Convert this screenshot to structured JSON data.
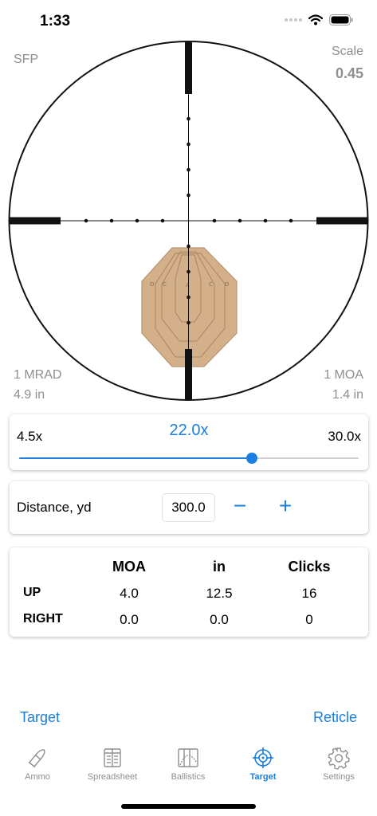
{
  "status_bar": {
    "time": "1:33"
  },
  "scope": {
    "focal_plane": "SFP",
    "scale_label": "Scale",
    "scale_value": "0.45",
    "left_unit": "1 MRAD",
    "left_size": "4.9 in",
    "right_unit": "1 MOA",
    "right_size": "1.4 in",
    "target_rings": [
      "D",
      "C",
      "A",
      "C",
      "D"
    ],
    "colors": {
      "target_fill": "#d4b08a",
      "target_stroke": "#b89470",
      "reticle": "#111111"
    }
  },
  "zoom": {
    "min_label": "4.5x",
    "max_label": "30.0x",
    "current_label": "22.0x",
    "min": 4.5,
    "max": 30.0,
    "current": 22.0
  },
  "distance": {
    "label": "Distance, yd",
    "value": "300.0",
    "minus_label": "−",
    "plus_label": "+"
  },
  "corrections": {
    "headers": [
      "MOA",
      "in",
      "Clicks"
    ],
    "rows": [
      {
        "label": "UP",
        "moa": "4.0",
        "in": "12.5",
        "clicks": "16"
      },
      {
        "label": "RIGHT",
        "moa": "0.0",
        "in": "0.0",
        "clicks": "0"
      }
    ]
  },
  "footer": {
    "target_link": "Target",
    "reticle_link": "Reticle"
  },
  "tabs": [
    {
      "label": "Ammo",
      "icon": "bullet-icon",
      "active": false
    },
    {
      "label": "Spreadsheet",
      "icon": "spreadsheet-icon",
      "active": false
    },
    {
      "label": "Ballistics",
      "icon": "ballistics-chart-icon",
      "active": false
    },
    {
      "label": "Target",
      "icon": "crosshair-icon",
      "active": true
    },
    {
      "label": "Settings",
      "icon": "gear-icon",
      "active": false
    }
  ],
  "accent_color": "#1a7fe0"
}
